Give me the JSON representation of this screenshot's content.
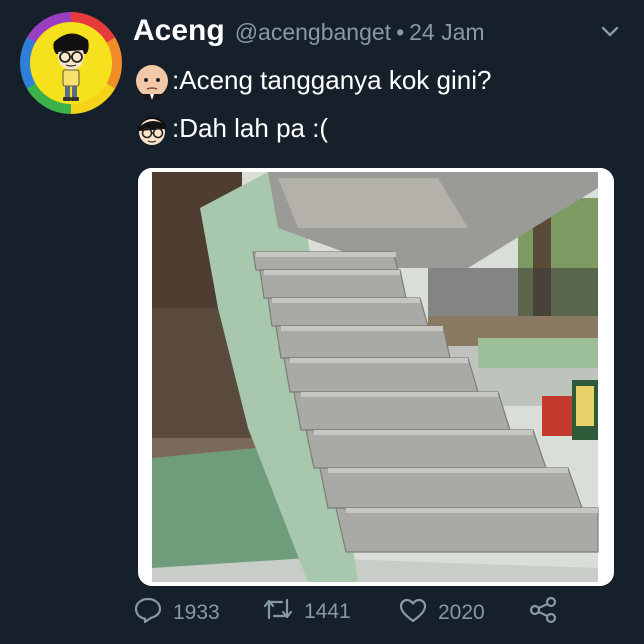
{
  "tweet": {
    "name": "Aceng",
    "handle": "@acengbanget",
    "separator": "•",
    "time": "24 Jam",
    "lines": [
      {
        "text": ":Aceng tangganya kok gini?",
        "emoji": "baby-face-icon"
      },
      {
        "text": ":Dah lah pa :(",
        "emoji": "cartoon-face-icon"
      }
    ],
    "photo": {
      "subject": "staircase-photo"
    }
  },
  "actions": {
    "reply_count": "1933",
    "retweet_count": "1441",
    "like_count": "2020"
  },
  "colors": {
    "background": "#15202b",
    "text_primary": "#ffffff",
    "text_secondary": "#8899a6",
    "avatar_bg": "#f6e21c"
  }
}
